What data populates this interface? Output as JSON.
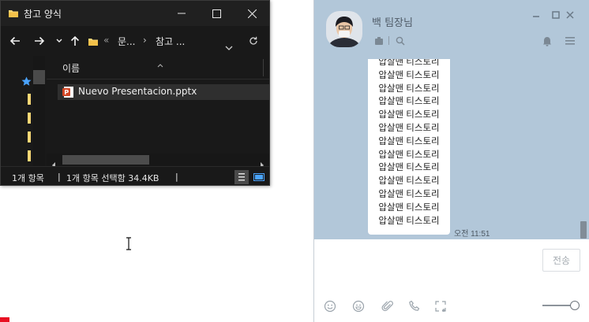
{
  "explorer": {
    "title": "참고 양식",
    "breadcrumb": [
      "문...",
      "참고 ..."
    ],
    "column_header": "이름",
    "files": [
      {
        "name": "Nuevo Presentacion.pptx",
        "icon": "powerpoint-file-icon"
      }
    ],
    "status": {
      "item_count": "1개 항목",
      "selection": "1개 항목 선택함 34.4KB"
    },
    "colors": {
      "background": "#191919",
      "folder": "#f8d775",
      "accent": "#4aa3ff"
    }
  },
  "chat": {
    "contact_name": "백 팀장님",
    "message_lines": [
      "압살맨 티스토리",
      "압살맨 티스토리",
      "압살맨 티스토리",
      "압살맨 티스토리",
      "압살맨 티스토리",
      "압살맨 티스토리",
      "압살맨 티스토리",
      "압살맨 티스토리",
      "압살맨 티스토리",
      "압살맨 티스토리",
      "압살맨 티스토리",
      "압살맨 티스토리",
      "압살맨 티스토리"
    ],
    "message_time": "오전 11:51",
    "send_label": "전송",
    "colors": {
      "background": "#b2c7d9",
      "bubble": "#ffffff"
    }
  }
}
